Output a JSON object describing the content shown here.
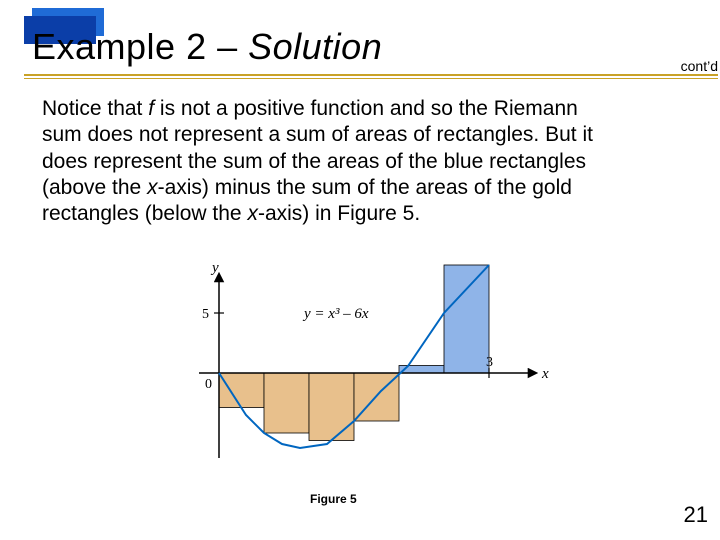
{
  "header": {
    "example_label": "Example 2 – ",
    "solution_label": "Solution",
    "contd": "cont’d"
  },
  "body": {
    "line1a": "Notice that ",
    "f": "f",
    "line1b": " is not a positive function and so the Riemann",
    "line2": "sum does not represent a sum of areas of rectangles. But it",
    "line3": "does represent the sum of the areas of the blue rectangles",
    "line4a": "(above the ",
    "x1": "x",
    "line4b": "-axis) minus the sum of the areas of the gold",
    "line5a": "rectangles (below the ",
    "x2": "x",
    "line5b": "-axis) in Figure 5."
  },
  "figure": {
    "caption": "Figure 5",
    "y_label": "y",
    "x_label": "x",
    "origin": "0",
    "x_tick": "3",
    "y_tick": "5",
    "curve_label": "y = x³ – 6x"
  },
  "chart_data": {
    "type": "bar",
    "title": "Riemann sum rectangles for y = x^3 - 6x on [0,3] with right endpoints, n = 6",
    "xlabel": "x",
    "ylabel": "y",
    "xlim": [
      0,
      3
    ],
    "ylim": [
      -7,
      10
    ],
    "dx": 0.5,
    "categories": [
      0.5,
      1.0,
      1.5,
      2.0,
      2.5,
      3.0
    ],
    "values": [
      -2.875,
      -5.0,
      -5.625,
      -4.0,
      0.625,
      9.0
    ],
    "curve": "y = x^3 - 6*x"
  },
  "page": "21"
}
